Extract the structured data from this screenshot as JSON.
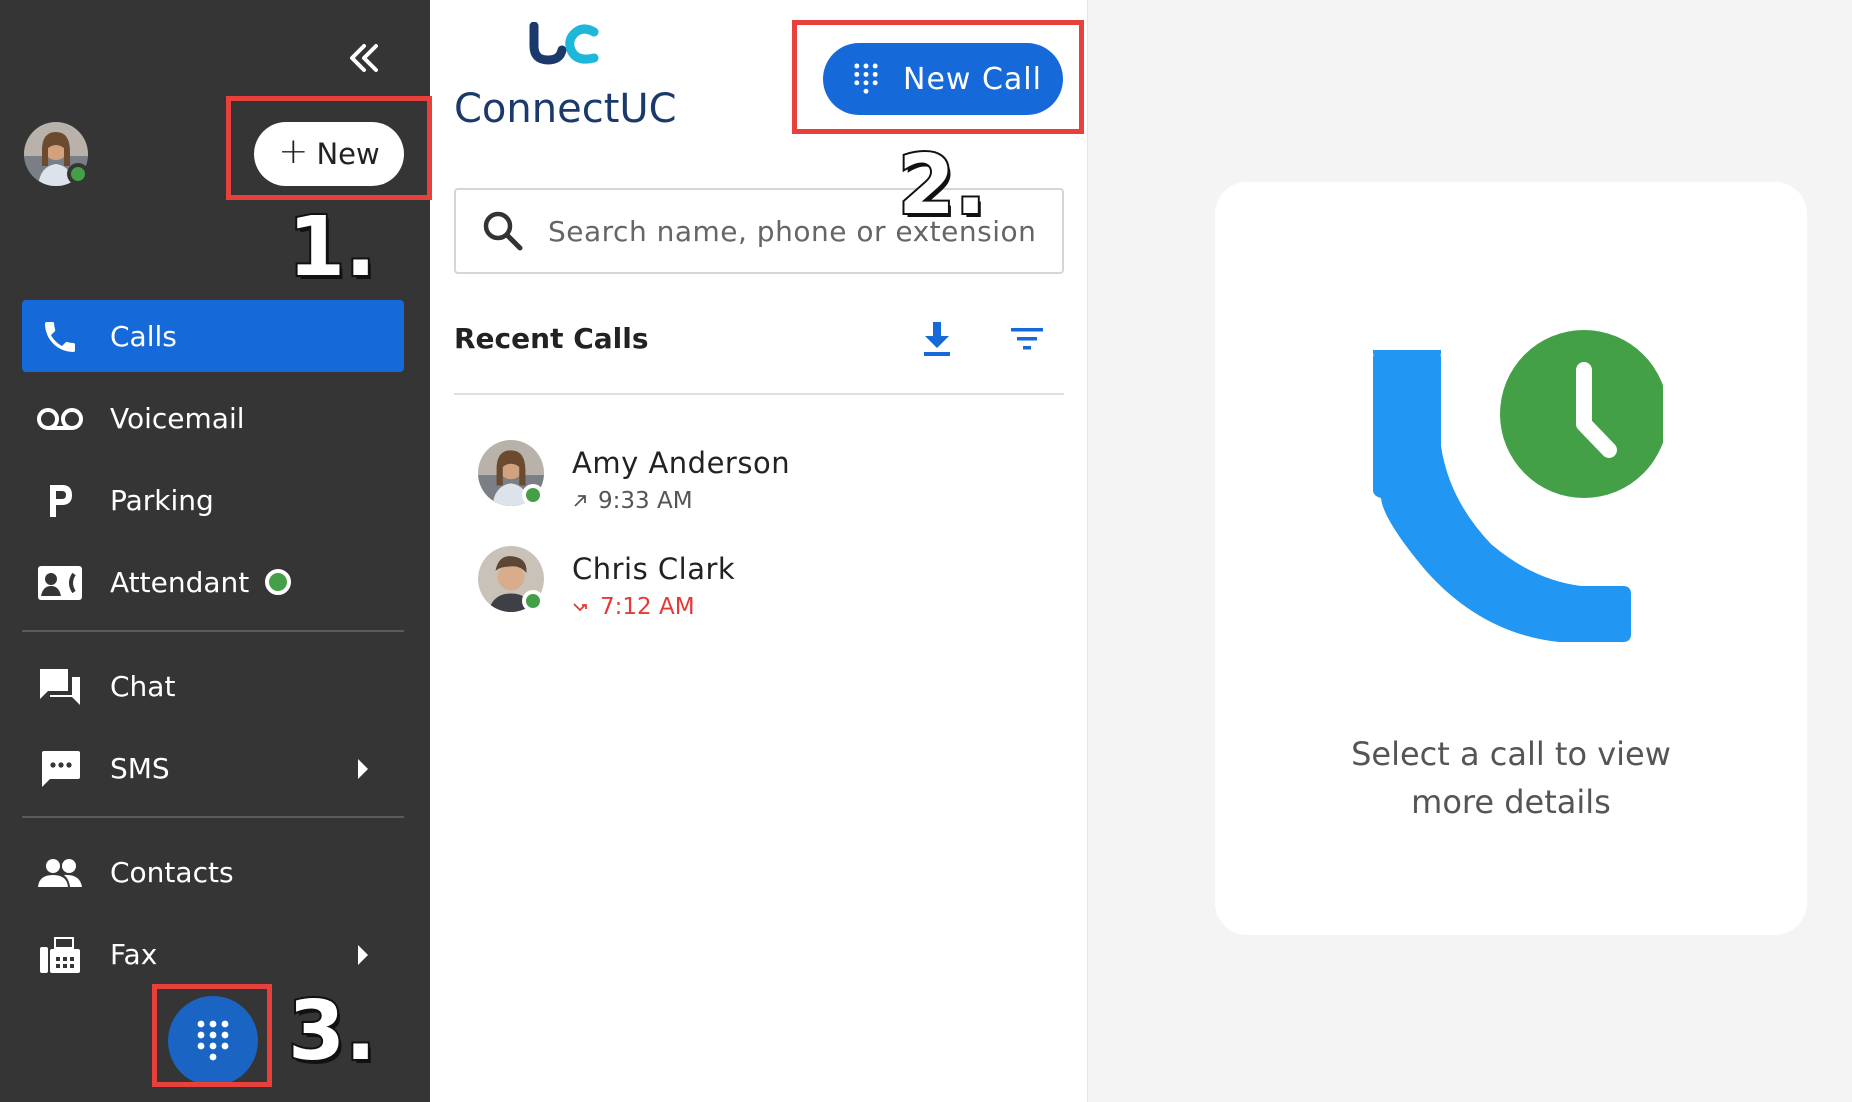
{
  "sidebar": {
    "new_label": "New",
    "items": [
      {
        "label": "Calls",
        "icon": "phone-icon"
      },
      {
        "label": "Voicemail",
        "icon": "voicemail-icon"
      },
      {
        "label": "Parking",
        "icon": "parking-icon"
      },
      {
        "label": "Attendant",
        "icon": "attendant-icon"
      },
      {
        "label": "Chat",
        "icon": "chat-icon"
      },
      {
        "label": "SMS",
        "icon": "sms-icon"
      },
      {
        "label": "Contacts",
        "icon": "contacts-icon"
      },
      {
        "label": "Fax",
        "icon": "fax-icon"
      }
    ]
  },
  "brand": {
    "logo_text": "ConnectUC",
    "logo_mark": "UC"
  },
  "mid": {
    "new_call_label": "New Call",
    "search_placeholder": "Search name, phone or extension",
    "recent_title": "Recent Calls",
    "calls": [
      {
        "name": "Amy Anderson",
        "time": "9:33 AM",
        "direction": "outgoing"
      },
      {
        "name": "Chris Clark",
        "time": "7:12 AM",
        "direction": "missed"
      }
    ]
  },
  "detail": {
    "line1": "Select a call to view",
    "line2": "more details"
  },
  "annotations": {
    "one": "1.",
    "two": "2.",
    "three": "3."
  },
  "colors": {
    "sidebar_bg": "#353535",
    "accent": "#1669d9",
    "presence": "#43a047",
    "missed": "#e53935",
    "annotation": "#e8413c"
  }
}
